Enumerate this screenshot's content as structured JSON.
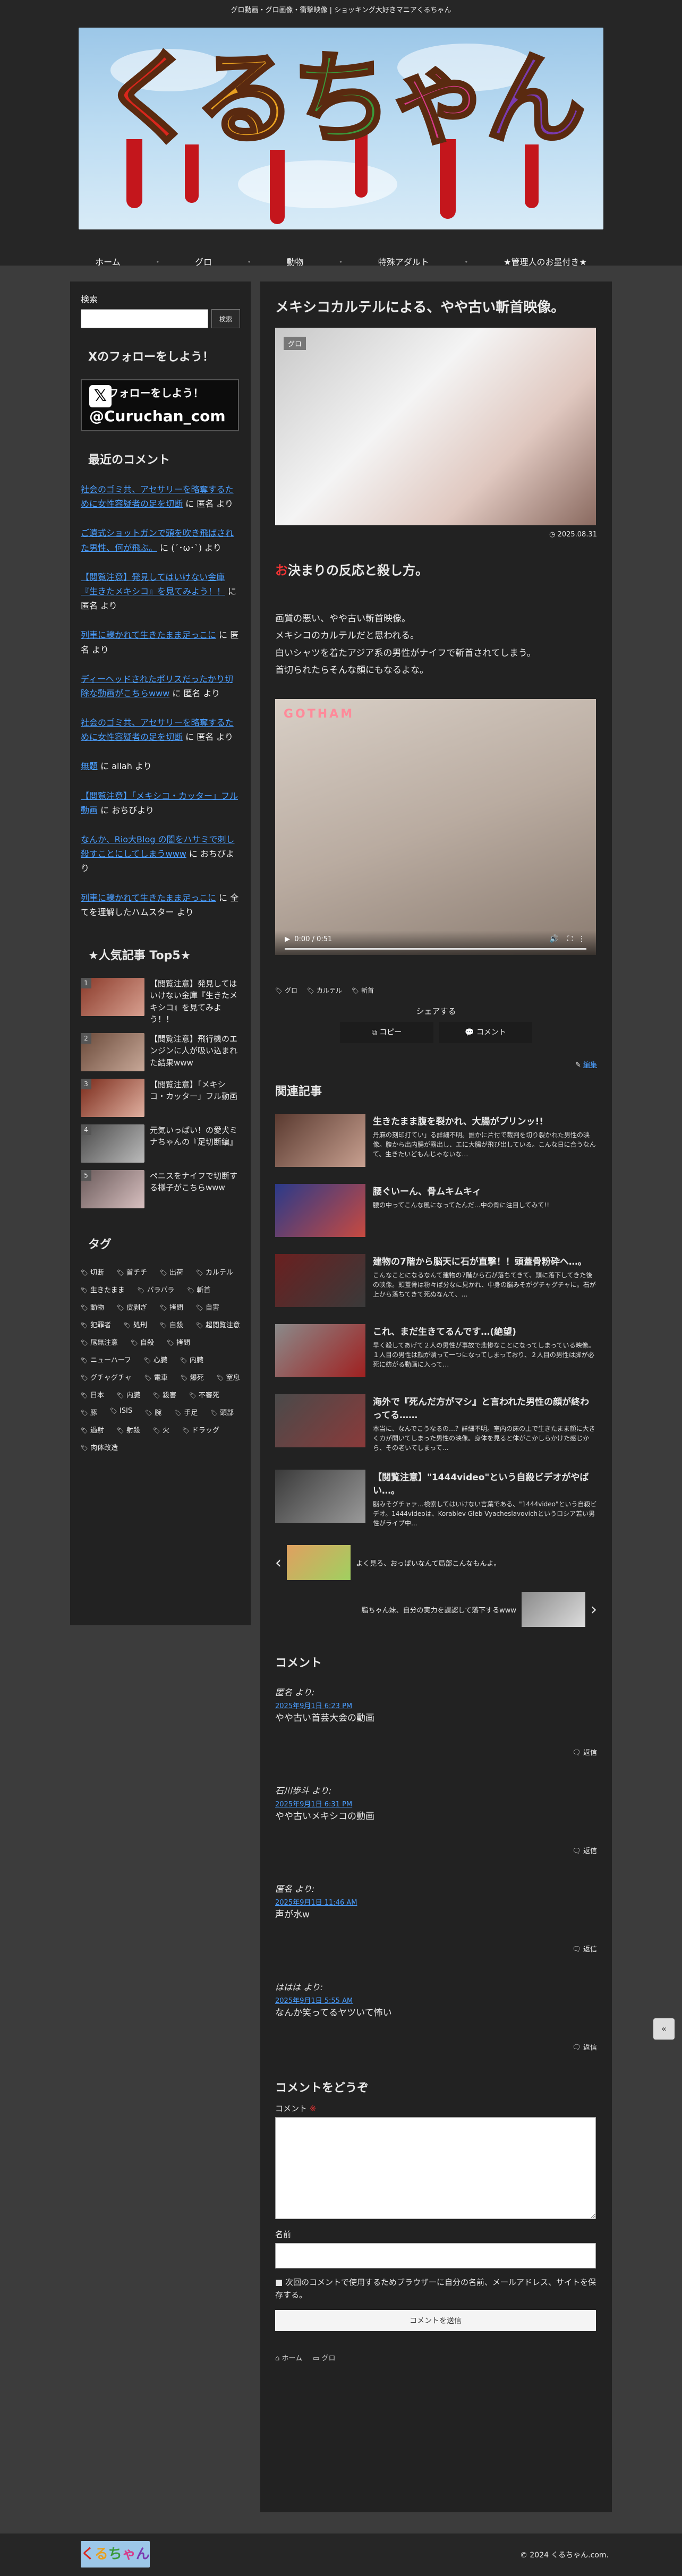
{
  "site": {
    "tagline": "グロ動画・グロ画像・衝撃映像 | ショッキング大好きマニアくるちゃん",
    "logo_text": "くるちゃん",
    "copyright": "© 2024 くるちゃん.com."
  },
  "nav": [
    "ホーム",
    "グロ",
    "動物",
    "特殊アダルト",
    "★管理人のお墨付き★"
  ],
  "nav_sep": "・",
  "sidebar": {
    "search_label": "検索",
    "search_button": "検索",
    "follow_title": "Xのフォローをしよう！",
    "follow_banner_top": "Xのフォローをしよう！",
    "follow_banner_handle": "@Curuchan_com",
    "recent_title": "最近のコメント",
    "comments": [
      {
        "link": "社会のゴミ共、アセサリーを略奪するために女性容疑者の足を切断",
        "tail": "に 匿名 より"
      },
      {
        "link": "ご遺式ショットガンで頭を吹き飛ばされた男性、何が飛ぶ。",
        "tail": "に (´･ω･`) より"
      },
      {
        "link": "【閲覧注意】発見してはいけない金庫『生きたメキシコ』を見てみよう！！",
        "tail": "に 匿名 より"
      },
      {
        "link": "列車に轢かれて生きたまま足っこに",
        "tail": "に 匿名 より"
      },
      {
        "link": "ディーヘッドされたポリスだったかり切除な動画がこちらwww",
        "tail": "に 匿名 より"
      },
      {
        "link": "社会のゴミ共、アセサリーを略奪するために女性容疑者の足を切断",
        "tail": "に 匿名 より"
      },
      {
        "link": "無題",
        "tail": "に allah より"
      },
      {
        "link": "【閲覧注意】「メキシコ・カッター」フル動画",
        "tail": "に おちびより"
      },
      {
        "link": "なんか、Rio大Blog の闇をハサミで刺し殺すことにしてしまうwww",
        "tail": "に おちびより"
      },
      {
        "link": "列車に轢かれて生きたまま足っこに",
        "tail": "に 全てを理解したハムスター より"
      }
    ],
    "popular_title": "★人気記事 Top5★",
    "popular": [
      {
        "num": "1",
        "text": "【閲覧注意】発見してはいけない金庫『生きたメキシコ』を見てみよう！！"
      },
      {
        "num": "2",
        "text": "【閲覧注意】飛行機のエンジンに人が吸い込まれた結果www"
      },
      {
        "num": "3",
        "text": "【閲覧注意】「メキシコ・カッター」フル動画"
      },
      {
        "num": "4",
        "text": "元気いっぱい！の愛犬ミナちゃんの『足切断編』"
      },
      {
        "num": "5",
        "text": "ペニスをナイフで切断する様子がこちらwww"
      }
    ],
    "tags_title": "タグ",
    "tags": [
      "切断",
      "首チチ",
      "出荷",
      "カルテル",
      "生きたまま",
      "バラバラ",
      "斬首",
      "動物",
      "皮剥ぎ",
      "拷問",
      "自害",
      "犯罪者",
      "処刑",
      "自殺",
      "超閲覧注意",
      "尾無注意",
      "自殺",
      "拷問",
      "ニューハーフ",
      "心臓",
      "内臓",
      "グチャグチャ",
      "電車",
      "爆死",
      "窒息",
      "日本",
      "内臓",
      "殺害",
      "不審死",
      "豚",
      "ISIS",
      "腕",
      "手足",
      "頭部",
      "過射",
      "射殺",
      "火",
      "ドラッグ",
      "肉体改造"
    ]
  },
  "post": {
    "title": "メキシコカルテルによる、やや古い斬首映像。",
    "category": "グロ",
    "date": "2025.08.31",
    "h2": "お決まりの反応と殺し方。",
    "body": [
      "画質の悪い、やや古い斬首映像。",
      "メキシコのカルテルだと思われる。",
      "白いシャツを着たアジア系の男性がナイフで斬首されてしまう。",
      "首切られたらそんな顔にもなるよな。"
    ],
    "video_watermark": "GOTHAM",
    "video_time": "0:00 / 0:51",
    "tags": [
      "グロ",
      "カルテル",
      "斬首"
    ],
    "share_label": "シェアする",
    "copy_label": "コピー",
    "comment_label": "コメント",
    "edit_label": "編集"
  },
  "related": {
    "title": "関連記事",
    "items": [
      {
        "title": "生きたまま腹を裂かれ、大腸がプリンッ!!",
        "desc": "丹麻の刻印打てい」る詳細不明。誰かに片付で裁判を切り裂かれた男性の映像。腹から出内腸が露出し、エに大腸が飛び出している。こんな日に合うなんて、生きたいどもんじゃないな…"
      },
      {
        "title": "腰ぐいーん、骨ムキムキィ",
        "desc": "腰の中ってこんな風になってたんだ…中の骨に注目してみて!!"
      },
      {
        "title": "建物の7階から脳天に石が直撃！！頭蓋骨粉砕へ…。",
        "desc": "こんなことになるなんて建物の7階から石が落ちてきて、頭に落下してきた後の映像。頭蓋骨は粉々ぱ分なに見かれ、中身の脳みそがグチャグチャに。石が上から落ちてきて死ぬなんて、…"
      },
      {
        "title": "これ、まだ生きてるんです…(絶望)",
        "desc": "早く殺してあげて２人の男性が事故で悲惨なことになってしまっている映像。１人目の男性は顔が潰って一つになってしまっており、２人目の男性は脚が必死に紡がる動画に入って…"
      },
      {
        "title": "海外で『死んだ方がマシ』と言われた男性の顔が終わってる……",
        "desc": "本当に、なんでこうなるの…？詳細不明。室内の床の上で生きたまま顔に大きくカが開いてしまった男性の映像。身体を見ると体がこかしらかけた感じから、その老いてしまって…"
      },
      {
        "title": "【閲覧注意】\"1444video\"という自殺ビデオがやばい…。",
        "desc": "脳みそグチャァ…検索してはいけない言葉である、\"1444video\"という自殺ビデオ。1444videoは、Korablev Gleb Vyacheslavovichというロシア若い男性がライブ中..."
      }
    ],
    "prev_text": "よく見ろ、おっぱいなんて局部こんなもんよ。",
    "next_text": "脂ちゃん妹、自分の実力を誤認して落下するwww"
  },
  "comments": {
    "title": "コメント",
    "reply_label": "返信",
    "items": [
      {
        "name": "匿名 より:",
        "date": "2025年9月1日 6:23 PM",
        "text": "やや古い首芸大会の動画"
      },
      {
        "name": "石川歩斗 より:",
        "date": "2025年9月1日 6:31 PM",
        "text": "やや古いメキシコの動画"
      },
      {
        "name": "匿名 より:",
        "date": "2025年9月1日 11:46 AM",
        "text": "声が水w"
      },
      {
        "name": "ははは より:",
        "date": "2025年9月1日 5:55 AM",
        "text": "なんか笑ってるヤツいて怖い"
      }
    ]
  },
  "form": {
    "title": "コメントをどうぞ",
    "comment_label": "コメント",
    "required_mark": "※",
    "name_label": "名前",
    "save_text": "次回のコメントで使用するためブラウザーに自分の名前、メールアドレス、サイトを保存する。",
    "submit_label": "コメントを送信"
  },
  "breadcrumb": [
    "ホーム",
    "グロ"
  ],
  "totop": "«"
}
